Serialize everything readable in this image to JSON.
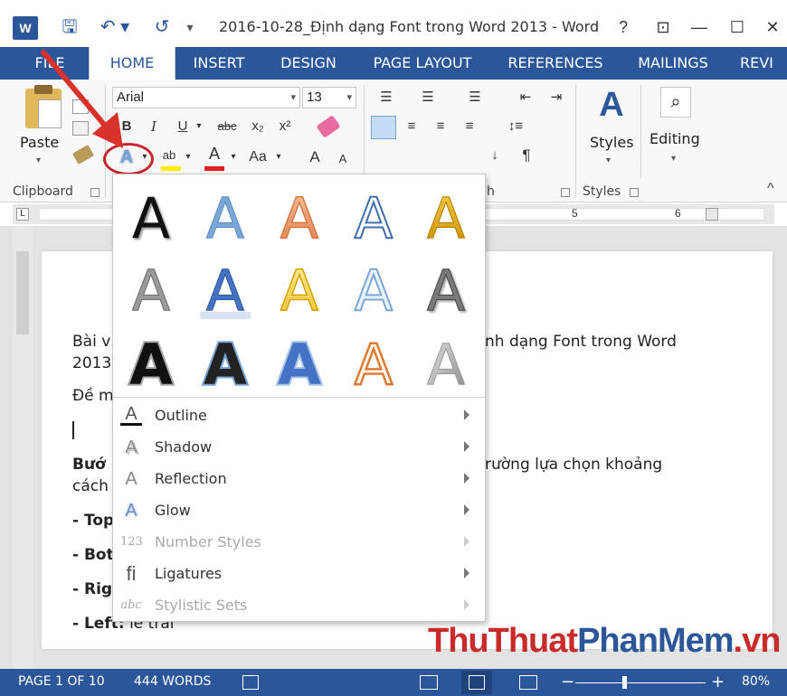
{
  "titlebar": {
    "logo": "W",
    "save": "🖫",
    "undo": "↶ ▾",
    "redo": "↺",
    "qat_more": "▾",
    "title": "2016-10-28_Định dạng Font trong Word 2013 - Word",
    "help": "?",
    "ribbon_display": "⊡",
    "minimize": "—",
    "maximize": "☐",
    "close": "✕"
  },
  "tabs": [
    "FILE",
    "HOME",
    "INSERT",
    "DESIGN",
    "PAGE LAYOUT",
    "REFERENCES",
    "MAILINGS",
    "REVI"
  ],
  "ribbon": {
    "paste_label": "Paste",
    "font_name": "Arial",
    "font_size": "13",
    "bold": "B",
    "italic": "I",
    "underline": "U",
    "strike": "abc",
    "subscript": "x₂",
    "superscript": "x²",
    "text_effects": "A",
    "highlight": "ab",
    "font_color": "A",
    "change_case": "Aa",
    "grow_font": "A",
    "shrink_font": "A",
    "styles_label": "Styles",
    "editing_label": "Editing",
    "clipboard_group": "Clipboard",
    "paragraph_group_tail": "h",
    "styles_group": "Styles",
    "collapse": "^"
  },
  "ruler": {
    "mark5": "5",
    "mark6": "6"
  },
  "document": {
    "line1_left": "Bài v",
    "line1_right": "nh dạng Font trong Word",
    "line2": "2013",
    "line3": "Đề m",
    "step_bold": "Bướ",
    "step_right": "rường lựa chọn khoảng",
    "step_line2": "cách",
    "item_top": "- Top",
    "item_bottom": "- Bot",
    "item_right": "- Rig",
    "item_left_bold": "- Left:",
    "item_left_rest": " lề trái"
  },
  "gallery": {
    "letter": "A",
    "menu": [
      {
        "label": "Outline",
        "icon": "A",
        "enabled": true
      },
      {
        "label": "Shadow",
        "icon": "A",
        "enabled": true
      },
      {
        "label": "Reflection",
        "icon": "A",
        "enabled": true
      },
      {
        "label": "Glow",
        "icon": "A",
        "enabled": true
      },
      {
        "label": "Number Styles",
        "icon": "123",
        "enabled": false
      },
      {
        "label": "Ligatures",
        "icon": "fi",
        "enabled": true
      },
      {
        "label": "Stylistic Sets",
        "icon": "abc",
        "enabled": false
      }
    ]
  },
  "statusbar": {
    "page": "PAGE 1 OF 10",
    "words": "444 WORDS",
    "zoom_minus": "−",
    "zoom_plus": "+",
    "zoom": "80%"
  },
  "watermark": {
    "part1": "ThuThuat",
    "part2": "PhanMem",
    "part3": ".vn"
  },
  "colors": {
    "word_blue": "#2b579a",
    "annotation_red": "#d9322a",
    "watermark_red": "#c92a2a"
  }
}
